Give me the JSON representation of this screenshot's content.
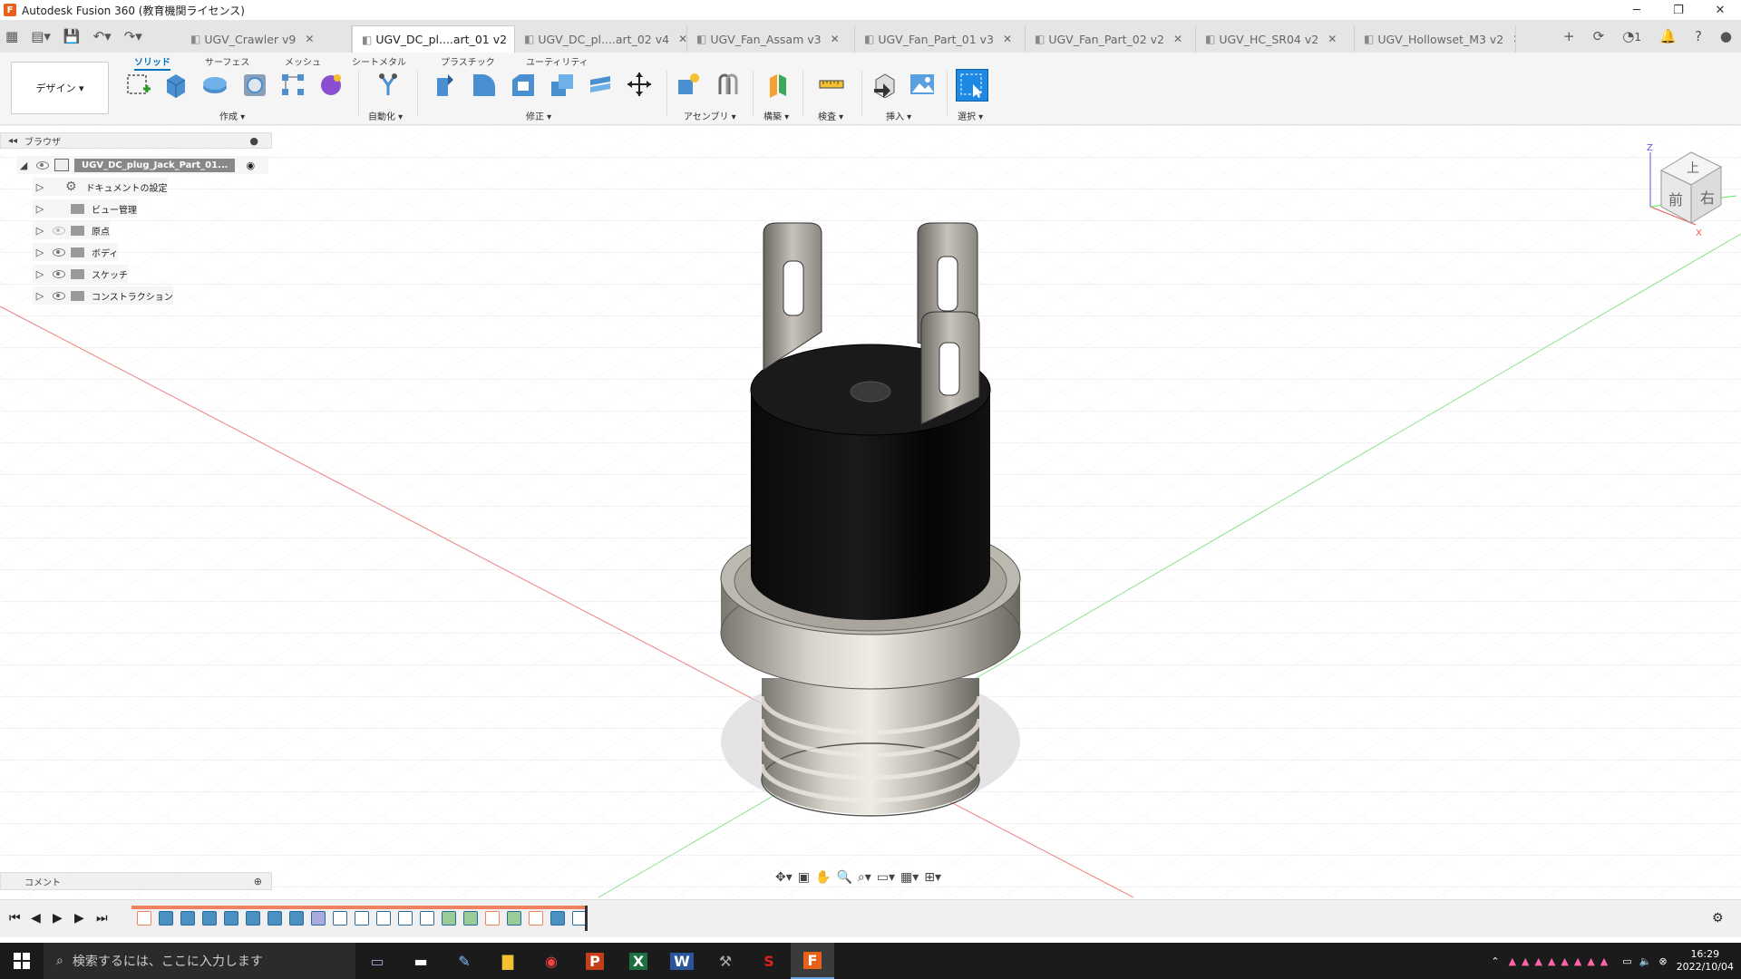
{
  "window": {
    "title": "Autodesk Fusion 360 (教育機関ライセンス)",
    "minimize": "─",
    "restore": "❐",
    "close": "✕"
  },
  "tabs": [
    {
      "label": "UGV_Crawler v9",
      "active": false
    },
    {
      "label": "UGV_DC_pl....art_01 v2",
      "active": true
    },
    {
      "label": "UGV_DC_pl....art_02 v4",
      "active": false
    },
    {
      "label": "UGV_Fan_Assam v3",
      "active": false
    },
    {
      "label": "UGV_Fan_Part_01 v3",
      "active": false
    },
    {
      "label": "UGV_Fan_Part_02 v2",
      "active": false
    },
    {
      "label": "UGV_HC_SR04 v2",
      "active": false
    },
    {
      "label": "UGV_Hollowset_M3 v2",
      "active": false
    }
  ],
  "tab_tools": {
    "job_count": "1"
  },
  "ribbon": {
    "mode": "デザイン ▾",
    "tabs": [
      "ソリッド",
      "サーフェス",
      "メッシュ",
      "シートメタル",
      "プラスチック",
      "ユーティリティ"
    ],
    "groups": [
      "作成 ▾",
      "自動化 ▾",
      "修正 ▾",
      "アセンブリ ▾",
      "構築 ▾",
      "検査 ▾",
      "挿入 ▾",
      "選択 ▾"
    ]
  },
  "browser": {
    "title": "ブラウザ",
    "root": "UGV_DC_plug_Jack_Part_01...",
    "nodes": [
      {
        "label": "ドキュメントの設定",
        "icon": "gear-icon",
        "eye": false
      },
      {
        "label": "ビュー管理",
        "icon": "folder-icon",
        "eye": false
      },
      {
        "label": "原点",
        "icon": "folder-icon",
        "eye": "off"
      },
      {
        "label": "ボディ",
        "icon": "folder-icon",
        "eye": true
      },
      {
        "label": "スケッチ",
        "icon": "folder-icon",
        "eye": true
      },
      {
        "label": "コンストラクション",
        "icon": "folder-icon",
        "eye": true
      }
    ]
  },
  "viewcube": {
    "top": "上",
    "front": "前",
    "right": "右",
    "axis_z": "Z",
    "axis_x": "X"
  },
  "comment": {
    "label": "コメント"
  },
  "taskbar": {
    "search_placeholder": "検索するには、ここに入力します",
    "time": "16:29",
    "date": "2022/10/04"
  },
  "colors": {
    "accent": "#0070c0",
    "fusion_orange": "#e8611a",
    "timeline_marker": "#f08060"
  }
}
